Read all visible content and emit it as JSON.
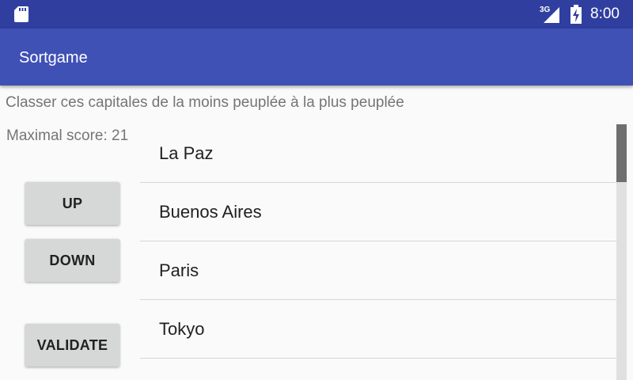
{
  "status_bar": {
    "network": "3G",
    "time": "8:00",
    "icons": [
      "sd-card-icon",
      "signal-icon",
      "battery-charging-icon"
    ]
  },
  "app_bar": {
    "title": "Sortgame"
  },
  "content": {
    "instruction": "Classer ces capitales de la moins peuplée à la plus peuplée",
    "max_score": "Maximal score: 21",
    "buttons": {
      "up": "UP",
      "down": "DOWN",
      "validate": "VALIDATE"
    },
    "cities": [
      "La Paz",
      "Buenos Aires",
      "Paris",
      "Tokyo"
    ]
  },
  "colors": {
    "primary": "#3f51b5",
    "primary_dark": "#303f9f",
    "background": "#fafafa",
    "button": "#d6d7d7"
  }
}
